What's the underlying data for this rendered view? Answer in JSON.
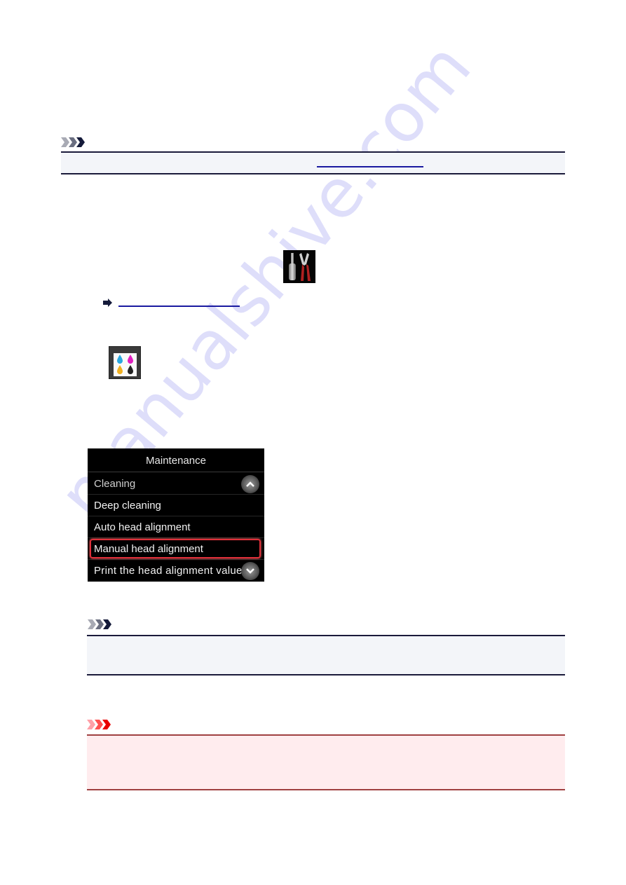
{
  "document": {
    "note_1": {
      "icon": "note-chevrons-icon",
      "link_text": "",
      "colors": {
        "border": "#1a1a3a",
        "background": "#f3f5f9"
      }
    },
    "step_icons": {
      "setup_icon": "setup-tools-icon",
      "reference_arrow": "arrow-right-icon",
      "reference_link_text": "",
      "maintenance_icon": "maintenance-ink-icon"
    },
    "lcd_menu": {
      "title": "Maintenance",
      "items": [
        {
          "label": "Cleaning",
          "selected": false
        },
        {
          "label": "Deep cleaning",
          "selected": false
        },
        {
          "label": "Auto head alignment",
          "selected": false
        },
        {
          "label": "Manual head alignment",
          "selected": true
        },
        {
          "label": "Print the head alignment value",
          "selected": false
        }
      ],
      "scroll_up_icon": "chevron-up-icon",
      "scroll_down_icon": "chevron-down-icon",
      "highlight_color": "#e0303a"
    },
    "note_2": {
      "icon": "note-chevrons-icon",
      "colors": {
        "border": "#1a1a3a",
        "background": "#f3f5f9"
      }
    },
    "important": {
      "icon": "important-chevrons-icon",
      "colors": {
        "border": "#a04040",
        "background": "#ffecee"
      }
    }
  },
  "watermark": {
    "text": "manualshive.com",
    "color": "#a0a0f0"
  }
}
